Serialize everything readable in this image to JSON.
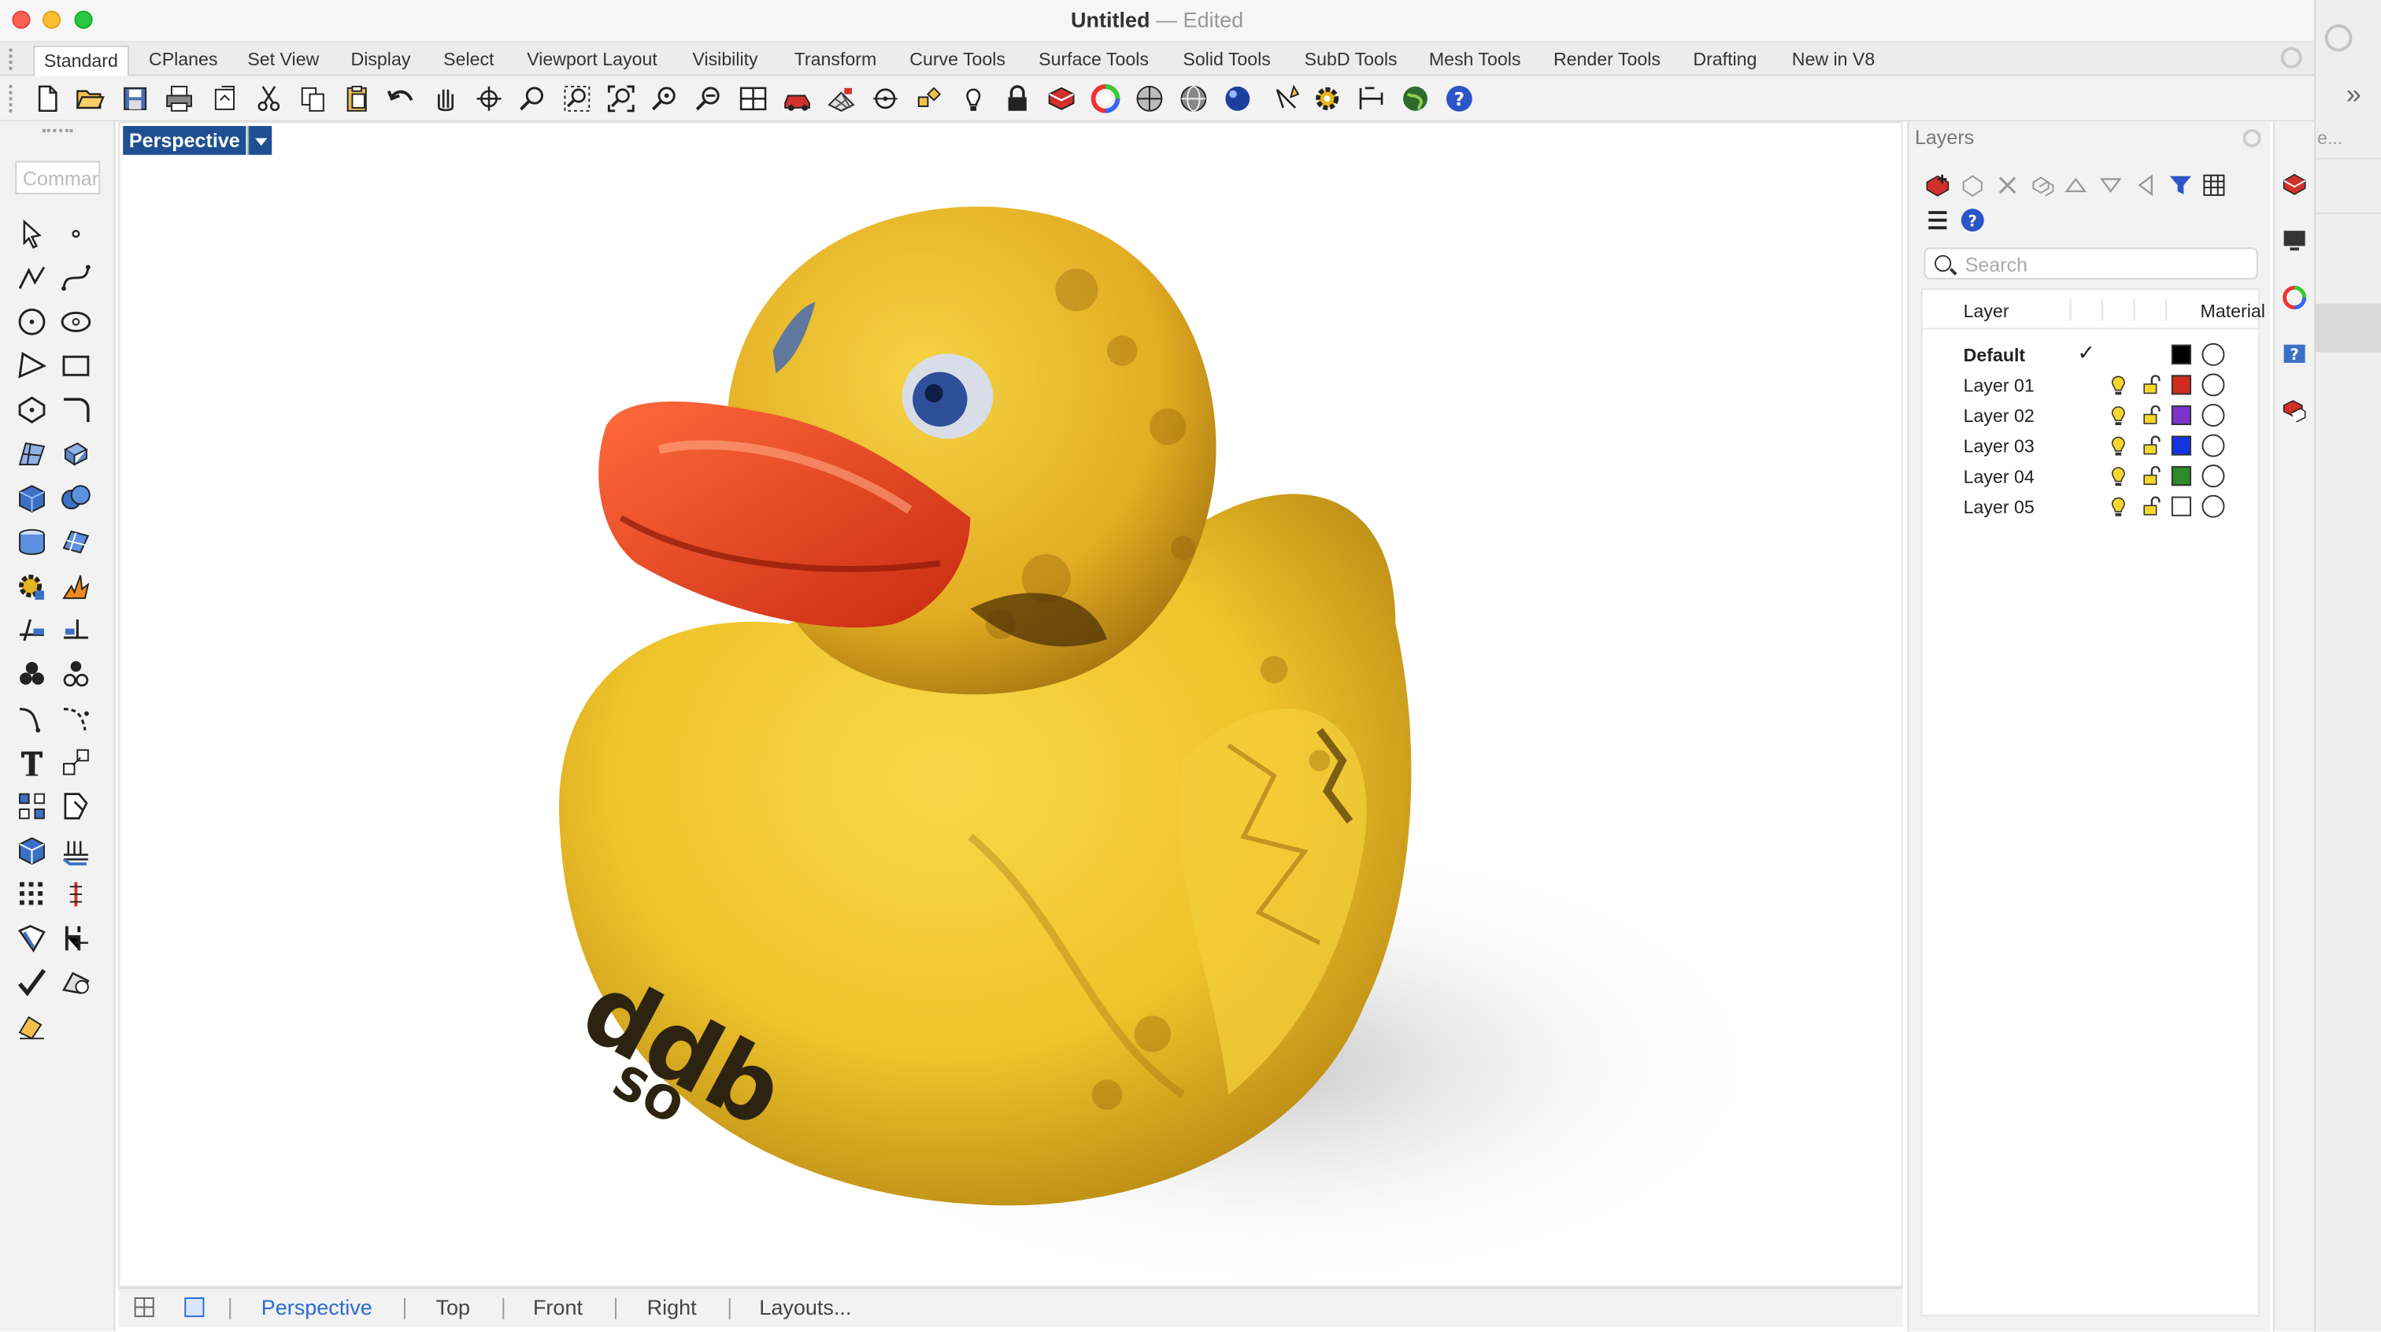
{
  "window": {
    "title": "Untitled",
    "separator": "—",
    "state": "Edited"
  },
  "tabs": [
    {
      "label": "Standard",
      "active": true
    },
    {
      "label": "CPlanes"
    },
    {
      "label": "Set View"
    },
    {
      "label": "Display"
    },
    {
      "label": "Select"
    },
    {
      "label": "Viewport Layout"
    },
    {
      "label": "Visibility"
    },
    {
      "label": "Transform"
    },
    {
      "label": "Curve Tools"
    },
    {
      "label": "Surface Tools"
    },
    {
      "label": "Solid Tools"
    },
    {
      "label": "SubD Tools"
    },
    {
      "label": "Mesh Tools"
    },
    {
      "label": "Render Tools"
    },
    {
      "label": "Drafting"
    },
    {
      "label": "New in V8"
    }
  ],
  "command": {
    "placeholder": "Command"
  },
  "viewport": {
    "label": "Perspective",
    "engraving_main": "ddb",
    "engraving_sub": "SO"
  },
  "viewport_tabs": [
    "Perspective",
    "Top",
    "Front",
    "Right",
    "Layouts..."
  ],
  "layers": {
    "title": "Layers",
    "search_placeholder": "Search",
    "col_layer": "Layer",
    "col_material": "Material",
    "rows": [
      {
        "name": "Default",
        "current": true,
        "color": "#000000"
      },
      {
        "name": "Layer 01",
        "color": "#d12b1f"
      },
      {
        "name": "Layer 02",
        "color": "#7b35cc"
      },
      {
        "name": "Layer 03",
        "color": "#1533e0"
      },
      {
        "name": "Layer 04",
        "color": "#2e8a2a"
      },
      {
        "name": "Layer 05",
        "color": "#ffffff"
      }
    ]
  },
  "background_window": {
    "text": "e..."
  },
  "accent": "#1d4f91",
  "link_color": "#2a6ad6"
}
